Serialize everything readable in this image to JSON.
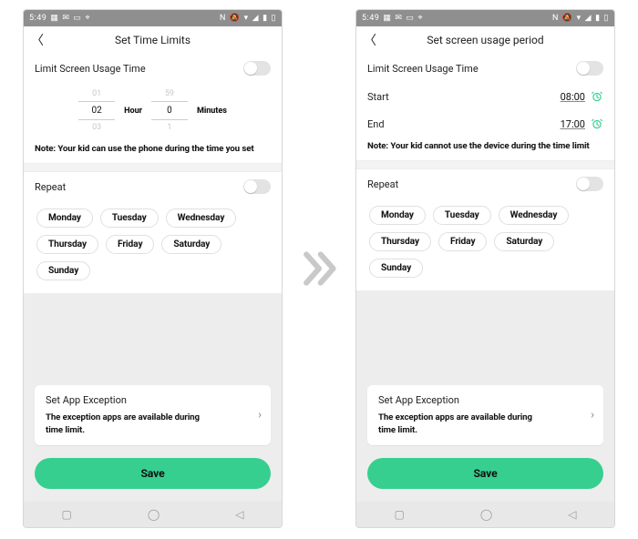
{
  "statusbar": {
    "time": "5:49",
    "left_icons": [
      "grid-icon",
      "message-icon",
      "calendar-icon",
      "location-icon"
    ],
    "right_icons": [
      "nfc-icon",
      "bell-off-icon",
      "wifi-icon",
      "signal-icon",
      "battery-icon",
      "user-icon"
    ]
  },
  "left": {
    "title": "Set Time Limits",
    "limit_label": "Limit Screen Usage Time",
    "picker": {
      "hour_prev": "01",
      "hour_cur": "02",
      "hour_next": "03",
      "hour_label": "Hour",
      "min_prev": "59",
      "min_cur": "0",
      "min_next": "1",
      "min_label": "Minutes"
    },
    "note": "Note: Your kid can use the phone during the time you set",
    "repeat_label": "Repeat",
    "days": [
      "Monday",
      "Tuesday",
      "Wednesday",
      "Thursday",
      "Friday",
      "Saturday",
      "Sunday"
    ],
    "card_title": "Set App Exception",
    "card_sub": "The exception apps are available during time limit.",
    "save": "Save"
  },
  "right": {
    "title": "Set screen usage period",
    "limit_label": "Limit Screen Usage Time",
    "start_label": "Start",
    "start_value": "08:00",
    "end_label": "End",
    "end_value": "17:00",
    "note": "Note: Your kid cannot use the device during the time limit",
    "repeat_label": "Repeat",
    "days": [
      "Monday",
      "Tuesday",
      "Wednesday",
      "Thursday",
      "Friday",
      "Saturday",
      "Sunday"
    ],
    "card_title": "Set App Exception",
    "card_sub": "The exception apps are available during time limit.",
    "save": "Save"
  },
  "accent": "#36cf8f"
}
